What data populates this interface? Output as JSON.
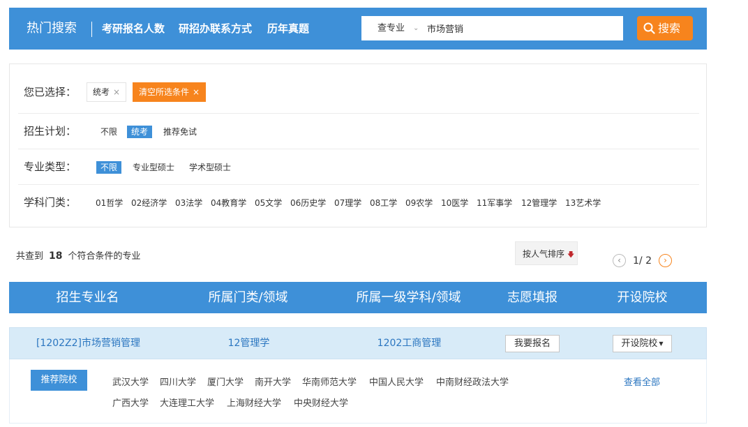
{
  "topbar": {
    "hot_label": "热门搜索",
    "links": [
      "考研报名人数",
      "研招办联系方式",
      "历年真题"
    ],
    "search": {
      "category": "查专业",
      "value": "市场营销"
    },
    "search_button": "搜索"
  },
  "filters": {
    "selected_label": "您已选择：",
    "selected_chip": "统考",
    "clear_label": "清空所选条件",
    "plan_label": "招生计划：",
    "plan_options": [
      "不限",
      "统考",
      "推荐免试"
    ],
    "type_label": "专业类型：",
    "type_options": [
      "不限",
      "专业型硕士",
      "学术型硕士"
    ],
    "subject_label": "学科门类：",
    "subject_options": [
      "01哲学",
      "02经济学",
      "03法学",
      "04教育学",
      "05文学",
      "06历史学",
      "07理学",
      "08工学",
      "09农学",
      "10医学",
      "11军事学",
      "12管理学",
      "13艺术学"
    ]
  },
  "results": {
    "prefix": "共查到",
    "count": "18",
    "suffix": "个符合条件的专业",
    "sort_label": "按人气排序",
    "pager": "1/ 2"
  },
  "table": {
    "headers": [
      "招生专业名",
      "所属门类/领域",
      "所属一级学科/领域",
      "志愿填报",
      "开设院校"
    ],
    "row": {
      "major": "[1202Z2]市场营销管理",
      "category": "12管理学",
      "discipline": "1202工商管理",
      "apply_button": "我要报名",
      "schools_button": "开设院校"
    }
  },
  "recommend": {
    "button": "推荐院校",
    "schools_line1": [
      "武汉大学",
      "四川大学",
      "厦门大学",
      "南开大学",
      "华南师范大学",
      "中国人民大学",
      "中南财经政法大学"
    ],
    "schools_line2": [
      "广西大学",
      "大连理工大学",
      "上海财经大学",
      "中央财经大学"
    ],
    "view_all": "查看全部"
  },
  "colors": {
    "brand_blue": "#3e90d8",
    "accent_orange": "#f7841d",
    "row_bg": "#d8ebf8",
    "link_blue": "#2b76c0"
  }
}
